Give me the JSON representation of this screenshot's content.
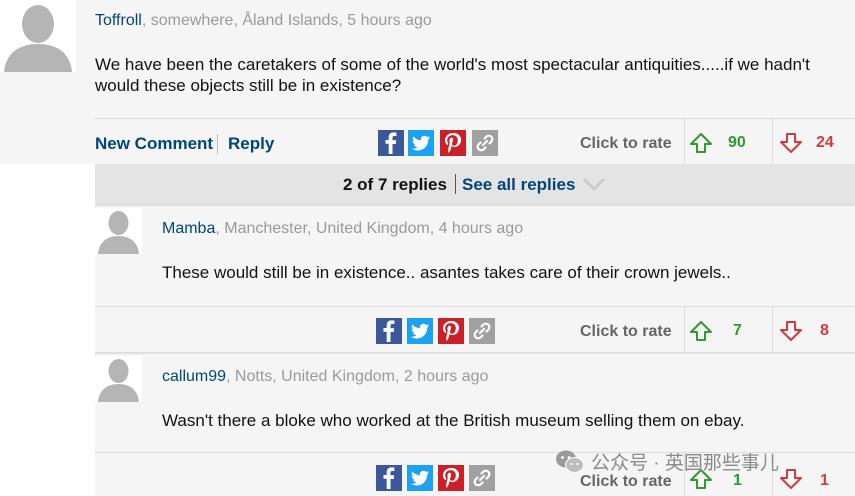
{
  "comments": [
    {
      "user": "Toffroll",
      "meta": ", somewhere, Åland Islands, 5 hours ago",
      "text_line1": "We have been the caretakers of some of the world's most spectacular antiquities.....if we hadn't",
      "text_line2": "would these objects still be in existence?",
      "new_comment_label": "New Comment",
      "reply_label": "Reply",
      "rate_label": "Click to rate",
      "up_votes": "90",
      "down_votes": "24"
    }
  ],
  "replies_bar": {
    "count_text": "2 of 7 replies",
    "see_all_label": "See all replies"
  },
  "replies": [
    {
      "user": "Mamba",
      "meta": ", Manchester, United Kingdom, 4 hours ago",
      "text": "These would still be in existence.. asantes takes care of their crown jewels..",
      "rate_label": "Click to rate",
      "up_votes": "7",
      "down_votes": "8"
    },
    {
      "user": "callum99",
      "meta": ", Notts, United Kingdom, 2 hours ago",
      "text": "Wasn't there a bloke who worked at the British museum selling them on ebay.",
      "rate_label": "Click to rate",
      "up_votes": "1",
      "down_votes": "1"
    }
  ],
  "watermark": {
    "text": "公众号 · 英国那些事儿",
    "icon": "wechat-icon"
  },
  "colors": {
    "link_blue": "#00457c",
    "up_green": "#2f9a2f",
    "down_red": "#d23b3b",
    "facebook": "#3b5998",
    "twitter": "#1da1f2",
    "pinterest": "#cb2027"
  },
  "icons": [
    "facebook-icon",
    "twitter-icon",
    "pinterest-icon",
    "link-icon",
    "arrow-up-icon",
    "arrow-down-icon",
    "chevron-down-icon",
    "default-avatar-icon"
  ]
}
